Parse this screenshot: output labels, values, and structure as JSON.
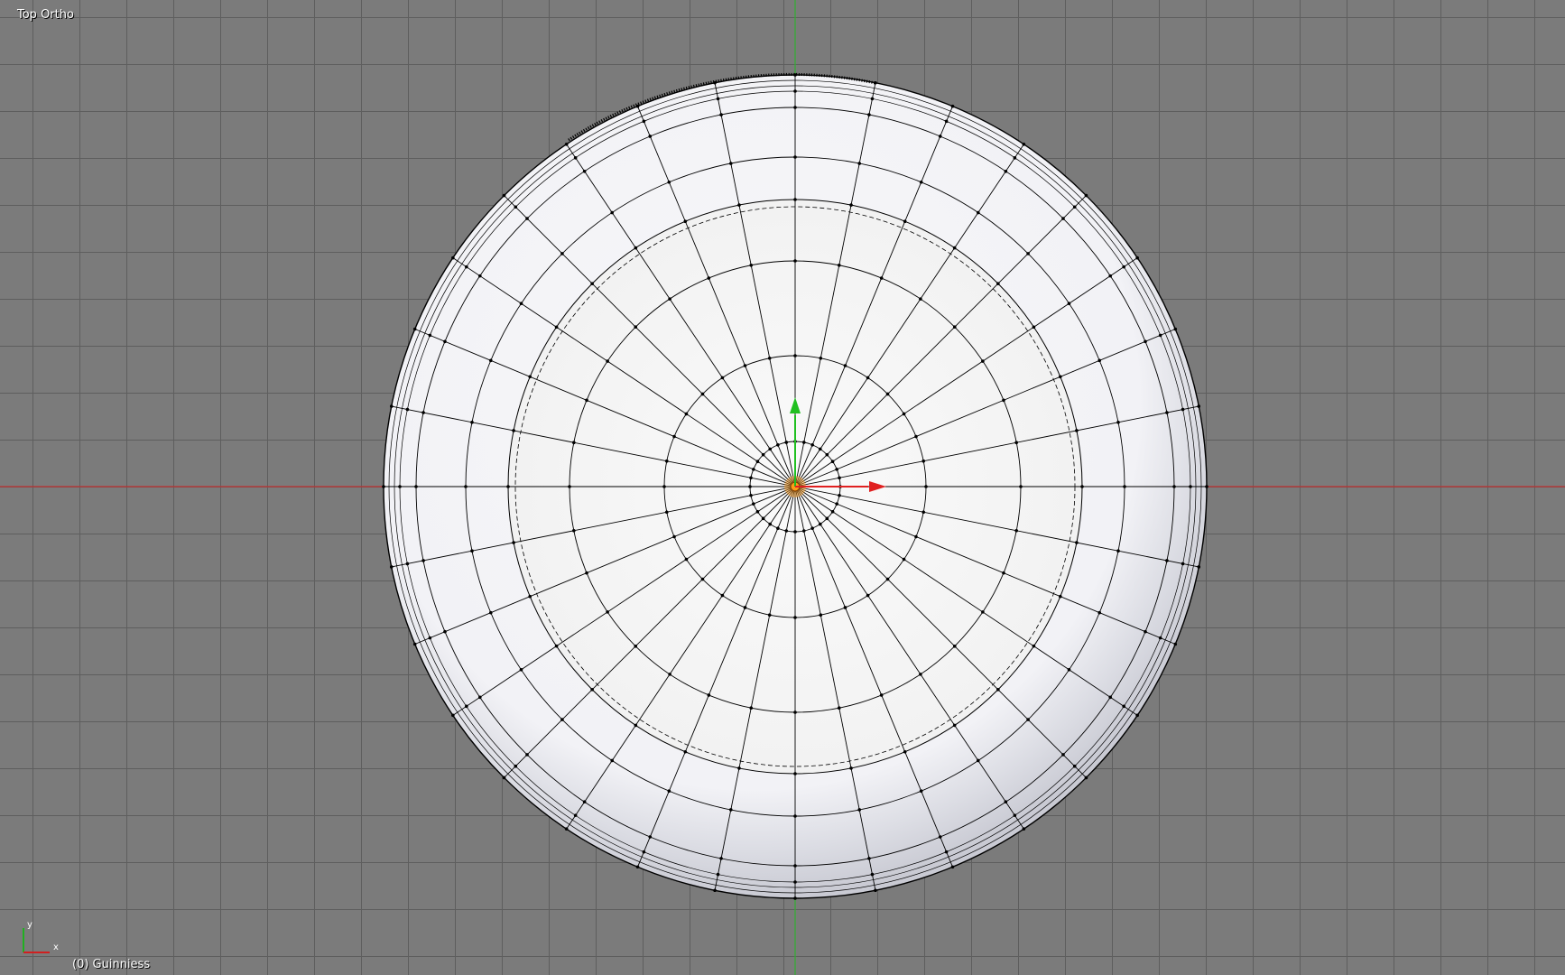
{
  "viewport": {
    "view_name": "Top Ortho",
    "object_label": "(0) Guinniess"
  },
  "gizmo": {
    "y_label": "y",
    "x_label": "x"
  },
  "colors": {
    "grid_bg": "#7b7b7b",
    "grid_line": "#5e5e5e",
    "x_axis": "#c03030",
    "y_axis": "#30b030",
    "mesh_face": "#f2f2f4",
    "wire": "#000000",
    "origin": "#ff9b1a"
  },
  "mesh": {
    "name": "Guinniess",
    "rings": 4,
    "segments": 32
  }
}
